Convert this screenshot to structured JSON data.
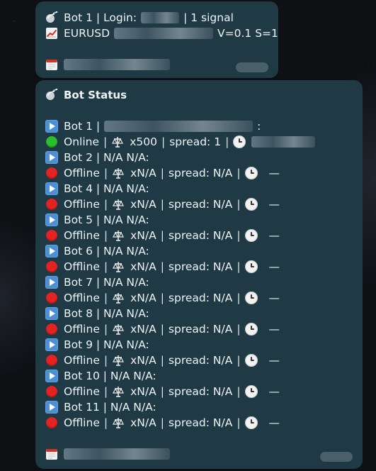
{
  "message1": {
    "line1": {
      "icon": "satellite-dish-icon",
      "prefix": "Bot 1 | Login:",
      "redaction": "",
      "suffix": "| 1 signal"
    },
    "line2": {
      "icon": "chart-increasing-icon",
      "symbol": "EURUSD",
      "params": "V=0.1 S=1"
    },
    "line3": {
      "icon": "calendar-icon"
    }
  },
  "message2": {
    "title_icon": "satellite-dish-icon",
    "title": "Bot Status",
    "bots": [
      {
        "bot_text": "Bot 1 |",
        "after_redaction": ":",
        "status": "Online",
        "status_icon": "green-circle-icon",
        "leverage": "x500",
        "spread": "spread: 1",
        "time": ""
      },
      {
        "bot_text": "Bot 2 | N/A N/A:",
        "status": "Offline",
        "status_icon": "red-circle-icon",
        "leverage": "xN/A",
        "spread": "spread: N/A",
        "time": "—"
      },
      {
        "bot_text": "Bot 4 | N/A N/A:",
        "status": "Offline",
        "status_icon": "red-circle-icon",
        "leverage": "xN/A",
        "spread": "spread: N/A",
        "time": "—"
      },
      {
        "bot_text": "Bot 5 | N/A N/A:",
        "status": "Offline",
        "status_icon": "red-circle-icon",
        "leverage": "xN/A",
        "spread": "spread: N/A",
        "time": "—"
      },
      {
        "bot_text": "Bot 6 | N/A N/A:",
        "status": "Offline",
        "status_icon": "red-circle-icon",
        "leverage": "xN/A",
        "spread": "spread: N/A",
        "time": "—"
      },
      {
        "bot_text": "Bot 7 | N/A N/A:",
        "status": "Offline",
        "status_icon": "red-circle-icon",
        "leverage": "xN/A",
        "spread": "spread: N/A",
        "time": "—"
      },
      {
        "bot_text": "Bot 8 | N/A N/A:",
        "status": "Offline",
        "status_icon": "red-circle-icon",
        "leverage": "xN/A",
        "spread": "spread: N/A",
        "time": "—"
      },
      {
        "bot_text": "Bot 9 | N/A N/A:",
        "status": "Offline",
        "status_icon": "red-circle-icon",
        "leverage": "xN/A",
        "spread": "spread: N/A",
        "time": "—"
      },
      {
        "bot_text": "Bot 10 | N/A N/A:",
        "status": "Offline",
        "status_icon": "red-circle-icon",
        "leverage": "xN/A",
        "spread": "spread: N/A",
        "time": "—"
      },
      {
        "bot_text": "Bot 11 | N/A N/A:",
        "status": "Offline",
        "status_icon": "red-circle-icon",
        "leverage": "xN/A",
        "spread": "spread: N/A",
        "time": "—"
      }
    ],
    "footer_icon": "calendar-icon"
  },
  "icons": {
    "play": "play-button-icon",
    "scale": "balance-scale-icon",
    "clock": "clock-icon"
  },
  "colors": {
    "bubble_bg": "#1f3a44",
    "text": "#eef3f6",
    "online": "#2bbf2b",
    "offline": "#e52222",
    "play": "#4b8fd6"
  }
}
